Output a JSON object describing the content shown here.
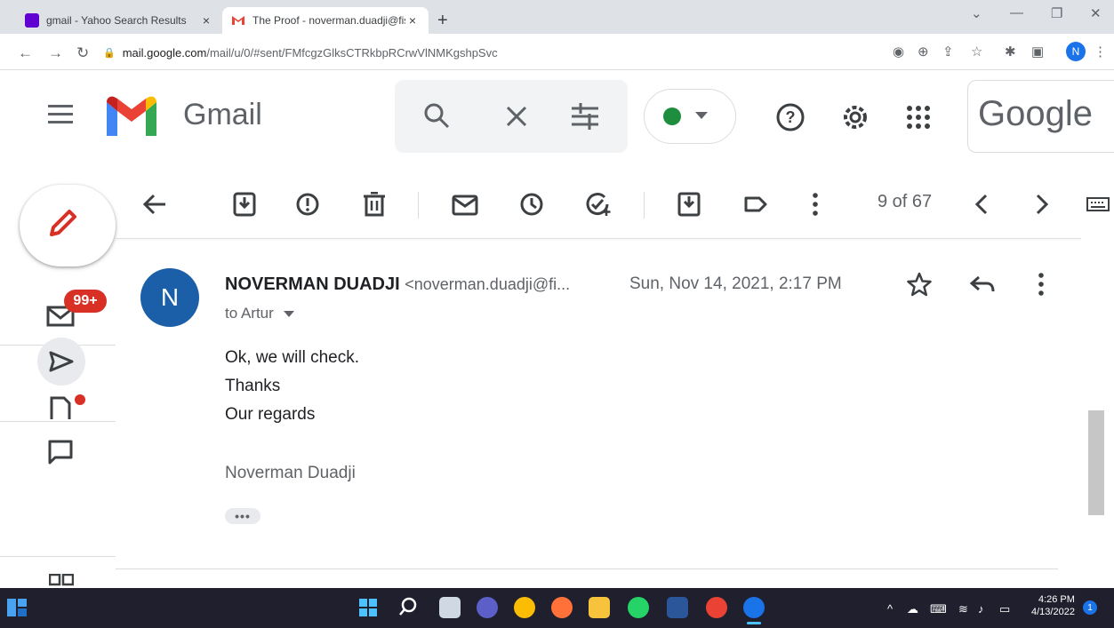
{
  "browser": {
    "tabs": [
      {
        "title": "gmail - Yahoo Search Results",
        "close": "×",
        "active": false
      },
      {
        "title": "The Proof - noverman.duadji@fis",
        "close": "×",
        "active": true
      }
    ],
    "new_tab": "+",
    "url_host": "mail.google.com",
    "url_path": "/mail/u/0/#sent/FMfcgzGlksCTRkbpRCrwVlNMKgshpSvc",
    "profile_initial": "N"
  },
  "gmail": {
    "app_name": "Gmail",
    "brand": "Google"
  },
  "nav": {
    "inbox_badge": "99+"
  },
  "toolbar": {
    "pager": "9 of 67"
  },
  "message": {
    "avatar_initial": "N",
    "sender_name": "NOVERMAN DUADJI",
    "sender_email": "<noverman.duadji@fi...",
    "date": "Sun, Nov 14, 2021, 2:17 PM",
    "to": "to Artur",
    "body": [
      "Ok, we  will check.",
      "Thanks",
      "Our regards"
    ],
    "signature": "Noverman Duadji",
    "trimmed": "•••"
  },
  "taskbar": {
    "time": "4:26 PM",
    "date": "4/13/2022",
    "notifications": "1"
  },
  "colors": {
    "accent": "#1a73e8",
    "badge": "#d93025",
    "avatar": "#1a5fa8",
    "status_dot": "#1e8e3e"
  }
}
